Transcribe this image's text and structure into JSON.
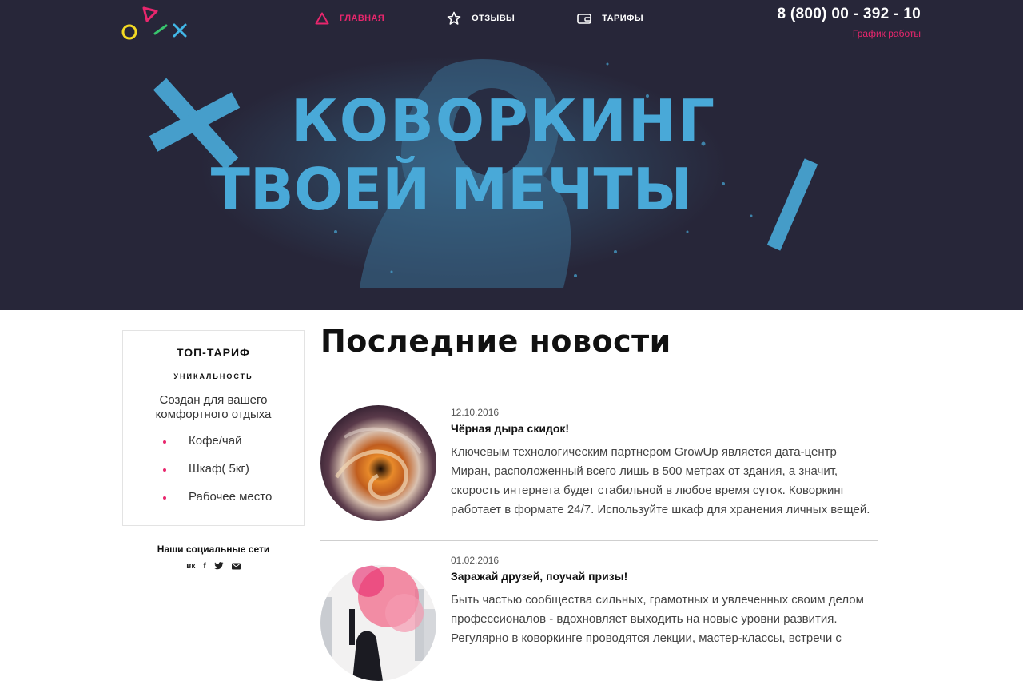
{
  "header": {
    "nav": [
      {
        "label": "ГЛАВНАЯ",
        "icon": "triangle-icon",
        "active": true
      },
      {
        "label": "ОТЗЫВЫ",
        "icon": "star-icon",
        "active": false
      },
      {
        "label": "ТАРИФЫ",
        "icon": "wallet-icon",
        "active": false
      }
    ],
    "phone": "8 (800) 00 - 392 - 10",
    "schedule_link": "График работы"
  },
  "hero": {
    "title_line1": "КОВОРКИНГ",
    "title_line2": "ТВОЕЙ МЕЧТЫ"
  },
  "sidebar": {
    "tariff": {
      "title": "ТОП-ТАРИФ",
      "subtitle": "УНИКАЛЬНОСТЬ",
      "description": "Создан для вашего комфортного отдыха",
      "features": [
        "Кофе/чай",
        "Шкаф( 5кг)",
        "Рабочее место"
      ]
    },
    "social": {
      "title": "Наши социальные сети",
      "icons": [
        "vk-icon",
        "facebook-icon",
        "twitter-icon",
        "mail-icon"
      ],
      "vk_label": "вк",
      "fb_label": "f"
    }
  },
  "news": {
    "heading": "Последние новости",
    "items": [
      {
        "date": "12.10.2016",
        "title": "Чёрная дыра скидок!",
        "text": "Ключевым технологическим партнером GrowUp является дата-центр Миран, расположенный всего лишь в 500 метрах от здания, а значит, скорость интернета будет стабильной в любое время суток. Коворкинг работает в формате 24/7. Используйте шкаф для хранения личных вещей."
      },
      {
        "date": "01.02.2016",
        "title": "Заражай друзей, поучай призы!",
        "text": "Быть частью сообщества сильных, грамотных и увлеченных своим делом профессионалов - вдохновляет выходить на новые уровни развития. Регулярно в коворкинге проводятся лекции, мастер-классы, встречи с"
      }
    ]
  },
  "colors": {
    "hero_bg": "#272639",
    "accent_pink": "#e8266d",
    "hero_blue": "#49a9d8"
  }
}
